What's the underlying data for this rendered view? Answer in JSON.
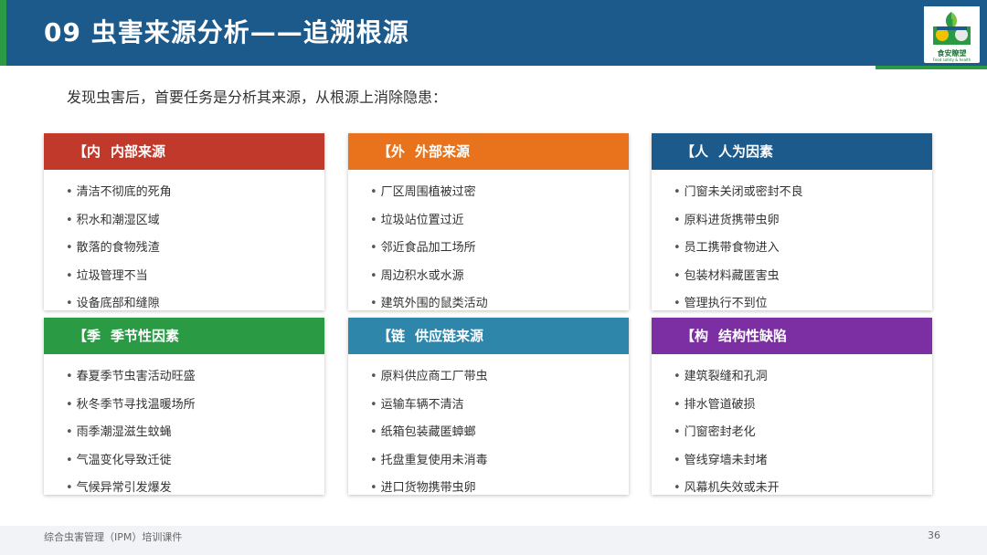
{
  "header": {
    "title": "09  虫害来源分析——追溯根源",
    "color": "#1d5a8c",
    "accent_color": "#2a9a45"
  },
  "logo": {
    "icon": "food-safety-logo",
    "text": "食安瞭望",
    "subtext": "Food safety & health"
  },
  "intro": "发现虫害后，首要任务是分析其来源，从根源上消除隐患：",
  "cards": [
    {
      "bracket": "【内",
      "title": "内部来源",
      "color": "#c0392b",
      "items": [
        "清洁不彻底的死角",
        "积水和潮湿区域",
        "散落的食物残渣",
        "垃圾管理不当",
        "设备底部和缝隙"
      ]
    },
    {
      "bracket": "【外",
      "title": "外部来源",
      "color": "#e8731c",
      "items": [
        "厂区周围植被过密",
        "垃圾站位置过近",
        "邻近食品加工场所",
        "周边积水或水源",
        "建筑外围的鼠类活动"
      ]
    },
    {
      "bracket": "【人",
      "title": "人为因素",
      "color": "#1d5a8c",
      "items": [
        "门窗未关闭或密封不良",
        "原料进货携带虫卵",
        "员工携带食物进入",
        "包装材料藏匿害虫",
        "管理执行不到位"
      ]
    },
    {
      "bracket": "【季",
      "title": "季节性因素",
      "color": "#2a9a45",
      "items": [
        "春夏季节虫害活动旺盛",
        "秋冬季节寻找温暖场所",
        "雨季潮湿滋生蚊蝇",
        "气温变化导致迁徙",
        "气候异常引发爆发"
      ]
    },
    {
      "bracket": "【链",
      "title": "供应链来源",
      "color": "#2e86ab",
      "items": [
        "原料供应商工厂带虫",
        "运输车辆不清洁",
        "纸箱包装藏匿蟑螂",
        "托盘重复使用未消毒",
        "进口货物携带虫卵"
      ]
    },
    {
      "bracket": "【构",
      "title": "结构性缺陷",
      "color": "#7b2fa3",
      "items": [
        "建筑裂缝和孔洞",
        "排水管道破损",
        "门窗密封老化",
        "管线穿墙未封堵",
        "风幕机失效或未开"
      ]
    }
  ],
  "footer": {
    "text": "综合虫害管理（IPM）培训课件",
    "page": "36"
  }
}
